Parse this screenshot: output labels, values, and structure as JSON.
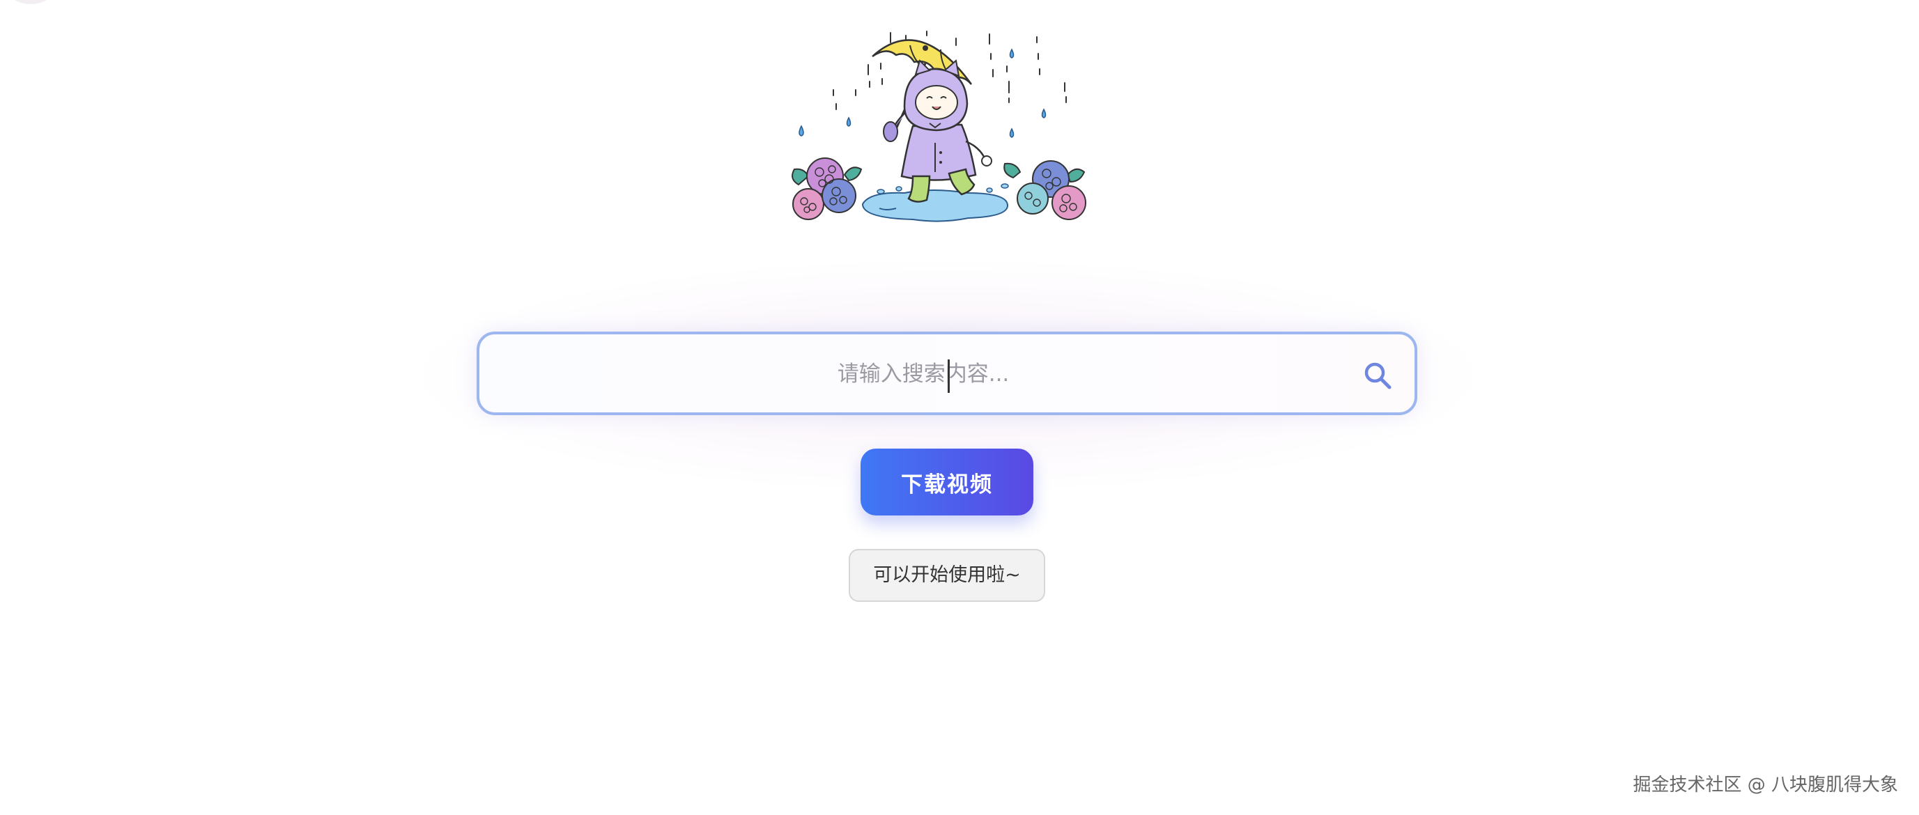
{
  "search": {
    "placeholder": "请输入搜索内容...",
    "value": ""
  },
  "actions": {
    "download_label": "下载视频"
  },
  "status": {
    "message": "可以开始使用啦~"
  },
  "footer": {
    "watermark": "掘金技术社区 @ 八块腹肌得大象"
  },
  "icons": {
    "search": "search-icon"
  },
  "colors": {
    "accent_start": "#3f78f5",
    "accent_end": "#5a49e4",
    "search_border": "#9db6ef",
    "search_icon": "#6f86e0"
  }
}
